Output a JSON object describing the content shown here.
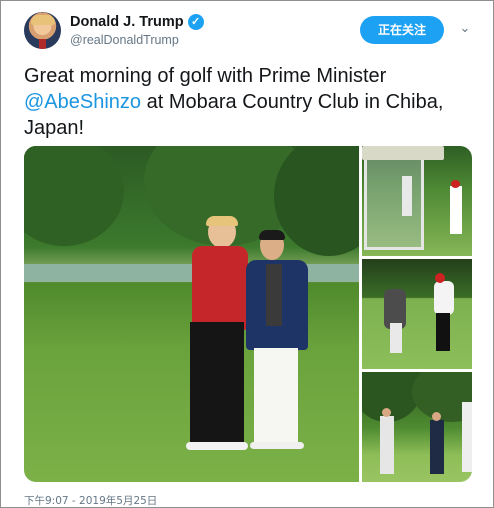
{
  "user": {
    "display_name": "Donald J. Trump",
    "verified_icon": "✓",
    "handle": "@realDonaldTrump"
  },
  "actions": {
    "follow_label": "正在关注",
    "caret_icon": "⌄"
  },
  "tweet": {
    "text_before": "Great morning of golf with Prime Minister ",
    "mention": "@AbeShinzo",
    "text_after": " at Mobara Country Club in Chiba, Japan!"
  },
  "timestamp": "下午9:07 - 2019年5月25日",
  "colors": {
    "accent": "#1da1f2",
    "mention": "#1b95e0",
    "secondary_text": "#657786"
  }
}
